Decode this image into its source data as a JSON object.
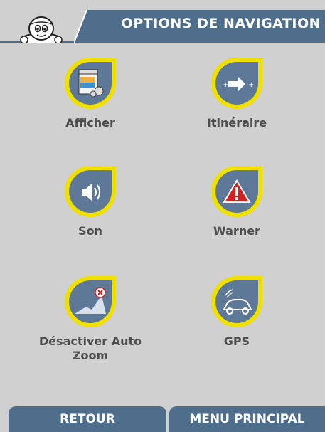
{
  "header": {
    "title": "OPTIONS DE NAVIGATION"
  },
  "menu": {
    "items": [
      {
        "label": "Afficher",
        "icon": "display-settings-icon"
      },
      {
        "label": "Itinéraire",
        "icon": "route-arrow-icon"
      },
      {
        "label": "Son",
        "icon": "speaker-icon"
      },
      {
        "label": "Warner",
        "icon": "warning-triangle-icon"
      },
      {
        "label": "Désactiver Auto Zoom",
        "icon": "auto-zoom-off-icon"
      },
      {
        "label": "GPS",
        "icon": "gps-car-icon"
      }
    ]
  },
  "footer": {
    "back_label": "RETOUR",
    "main_menu_label": "MENU PRINCIPAL"
  },
  "colors": {
    "background": "#d0d0d0",
    "header": "#4e6e8c",
    "footer_button": "#4e6e8c",
    "icon_ring": "#f0e000",
    "icon_fill": "#5e7898",
    "label_text": "#4e4e4e"
  }
}
